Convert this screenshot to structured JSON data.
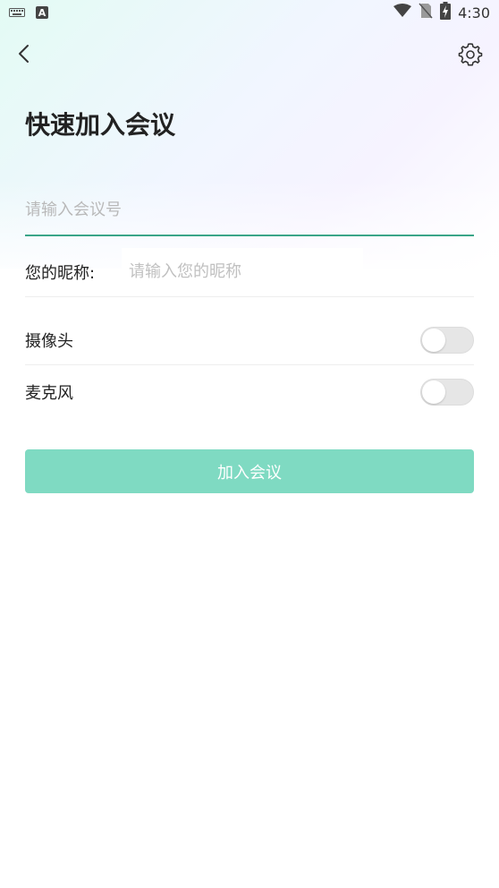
{
  "status_bar": {
    "time": "4:30",
    "icons": [
      "keyboard-icon",
      "a-notification-icon",
      "wifi-icon",
      "no-sim-icon",
      "battery-charging-icon"
    ]
  },
  "header": {
    "back_icon": "chevron-left-icon",
    "settings_icon": "gear-icon"
  },
  "page": {
    "title": "快速加入会议"
  },
  "form": {
    "meeting_number": {
      "value": "",
      "placeholder": "请输入会议号"
    },
    "nickname": {
      "label": "您的昵称:",
      "value": "",
      "placeholder": "请输入您的昵称"
    },
    "camera": {
      "label": "摄像头",
      "enabled": false
    },
    "microphone": {
      "label": "麦克风",
      "enabled": false
    },
    "join_button_label": "加入会议"
  },
  "colors": {
    "accent": "#3aa588",
    "button_disabled": "#7fdac2",
    "toggle_off": "#e6e6e6"
  }
}
